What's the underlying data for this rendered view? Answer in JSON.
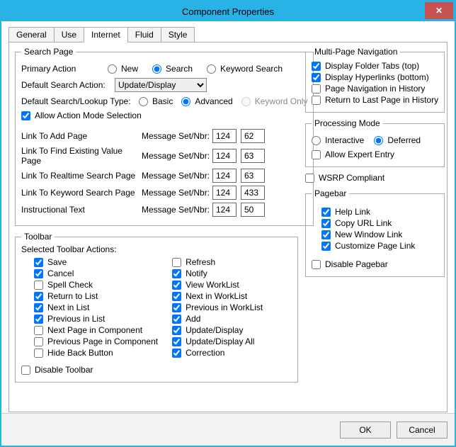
{
  "window": {
    "title": "Component Properties",
    "close_icon": "✕"
  },
  "tabs": {
    "general": "General",
    "use": "Use",
    "internet": "Internet",
    "fluid": "Fluid",
    "style": "Style"
  },
  "search_page": {
    "legend": "Search Page",
    "primary_action_label": "Primary Action",
    "new": "New",
    "search": "Search",
    "keyword_search": "Keyword Search",
    "default_search_action_label": "Default Search Action:",
    "default_search_action_value": "Update/Display",
    "default_lookup_type_label": "Default Search/Lookup Type:",
    "basic": "Basic",
    "advanced": "Advanced",
    "keyword_only": "Keyword Only",
    "allow_action_mode": "Allow Action Mode Selection",
    "msg_set_nbr": "Message Set/Nbr:",
    "links": {
      "add": {
        "label": "Link To Add Page",
        "set": "124",
        "nbr": "62"
      },
      "find": {
        "label": "Link To Find Existing Value Page",
        "set": "124",
        "nbr": "63"
      },
      "realtime": {
        "label": "Link To Realtime Search Page",
        "set": "124",
        "nbr": "63"
      },
      "keyword": {
        "label": "Link To Keyword Search Page",
        "set": "124",
        "nbr": "433"
      },
      "instr": {
        "label": "Instructional Text",
        "set": "124",
        "nbr": "50"
      }
    }
  },
  "toolbar": {
    "legend": "Toolbar",
    "selected_label": "Selected Toolbar Actions:",
    "left": {
      "save": "Save",
      "cancel": "Cancel",
      "spell": "Spell Check",
      "return": "Return to List",
      "next": "Next in List",
      "prev": "Previous in List",
      "nextpage": "Next Page in Component",
      "prevpage": "Previous Page in Component",
      "hideback": "Hide Back Button"
    },
    "right": {
      "refresh": "Refresh",
      "notify": "Notify",
      "viewwl": "View WorkList",
      "nextwl": "Next in WorkList",
      "prevwl": "Previous in WorkList",
      "add": "Add",
      "upddisp": "Update/Display",
      "upddispall": "Update/Display All",
      "correction": "Correction"
    },
    "disable": "Disable Toolbar"
  },
  "mpn": {
    "legend": "Multi-Page Navigation",
    "folder_tabs": "Display Folder Tabs (top)",
    "hyperlinks": "Display Hyperlinks (bottom)",
    "page_nav_history": "Page Navigation in History",
    "return_last": "Return to Last Page in History"
  },
  "pmode": {
    "legend": "Processing Mode",
    "interactive": "Interactive",
    "deferred": "Deferred",
    "allow_expert": "Allow Expert Entry"
  },
  "wsrp": "WSRP Compliant",
  "pagebar": {
    "legend": "Pagebar",
    "help": "Help Link",
    "copyurl": "Copy URL Link",
    "newwin": "New Window Link",
    "custom": "Customize Page Link",
    "disable": "Disable Pagebar"
  },
  "buttons": {
    "ok": "OK",
    "cancel": "Cancel"
  }
}
